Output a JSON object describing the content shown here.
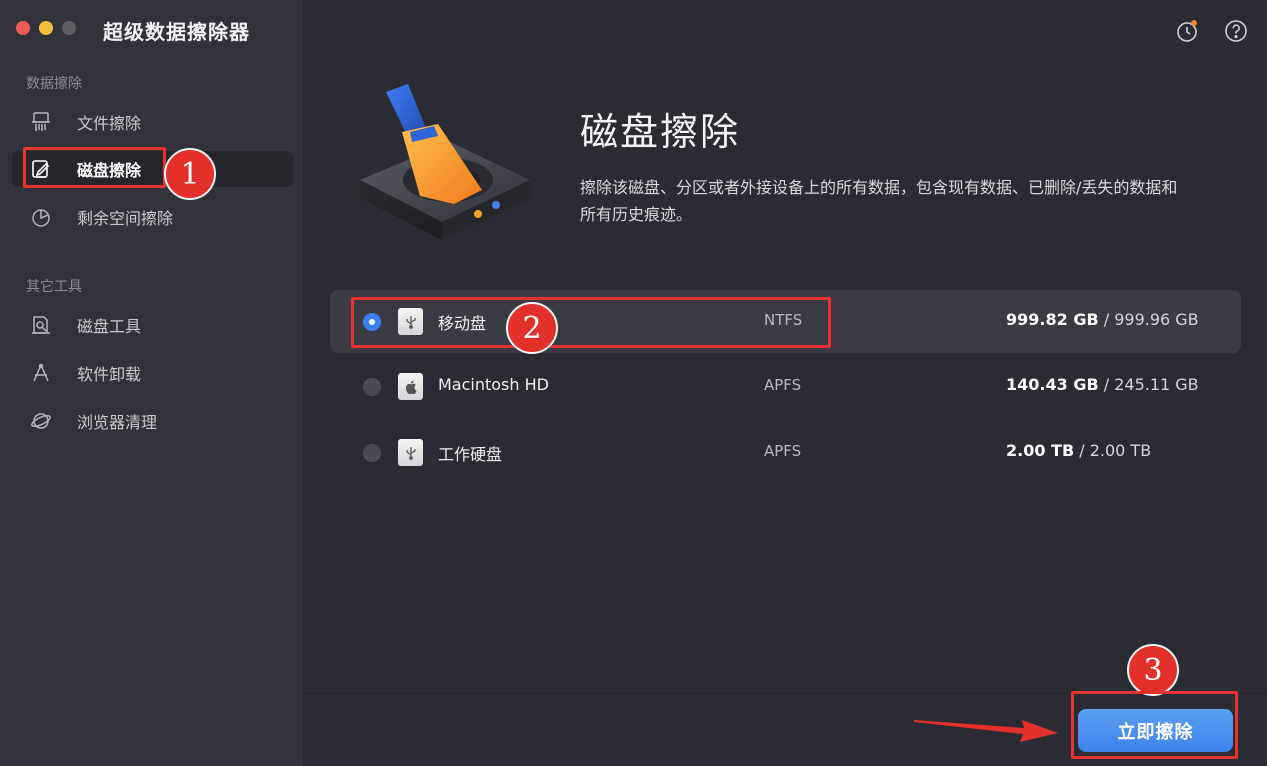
{
  "app": {
    "title": "超级数据擦除器"
  },
  "sidebar": {
    "section1": "数据擦除",
    "section2": "其它工具",
    "items": [
      {
        "label": "文件擦除",
        "icon": "shredder-icon"
      },
      {
        "label": "磁盘擦除",
        "icon": "edit-disk-icon",
        "active": true
      },
      {
        "label": "剩余空间擦除",
        "icon": "pie-chart-icon"
      },
      {
        "label": "磁盘工具",
        "icon": "disk-tool-icon"
      },
      {
        "label": "软件卸载",
        "icon": "uninstall-icon"
      },
      {
        "label": "浏览器清理",
        "icon": "browser-clean-icon"
      }
    ]
  },
  "header": {
    "title": "磁盘擦除",
    "description": "擦除该磁盘、分区或者外接设备上的所有数据，包含现有数据、已删除/丢失的数据和所有历史痕迹。"
  },
  "disks": [
    {
      "name": "移动盘",
      "fs": "NTFS",
      "used": "999.82 GB",
      "total": " / 999.96 GB",
      "icon": "usb-drive-icon",
      "selected": true
    },
    {
      "name": "Macintosh HD",
      "fs": "APFS",
      "used": "140.43 GB",
      "total": " / 245.11 GB",
      "icon": "apple-drive-icon",
      "selected": false
    },
    {
      "name": "工作硬盘",
      "fs": "APFS",
      "used": "2.00 TB",
      "total": " / 2.00 TB",
      "icon": "usb-drive-icon",
      "selected": false
    }
  ],
  "annotations": {
    "step1": "1",
    "step2": "2",
    "step3": "3"
  },
  "actions": {
    "erase_label": "立即擦除"
  },
  "colors": {
    "accent": "#3f83ea",
    "annotation": "#e4302b",
    "sidebar": "#32323a",
    "main": "#2b2b33"
  }
}
